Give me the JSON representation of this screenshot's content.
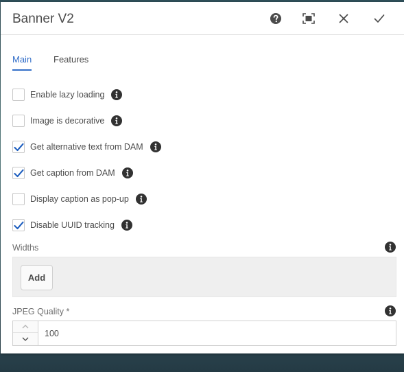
{
  "dialog": {
    "title": "Banner V2"
  },
  "tabs": [
    {
      "label": "Main",
      "active": true
    },
    {
      "label": "Features",
      "active": false
    }
  ],
  "checkboxes": [
    {
      "label": "Enable lazy loading",
      "checked": false
    },
    {
      "label": "Image is decorative",
      "checked": false
    },
    {
      "label": "Get alternative text from DAM",
      "checked": true
    },
    {
      "label": "Get caption from DAM",
      "checked": true
    },
    {
      "label": "Display caption as pop-up",
      "checked": false
    },
    {
      "label": "Disable UUID tracking",
      "checked": true
    }
  ],
  "widths": {
    "label": "Widths",
    "add_label": "Add"
  },
  "jpeg_quality": {
    "label": "JPEG Quality *",
    "value": "100"
  },
  "colors": {
    "accent": "#326ec8",
    "check": "#1f5fbf",
    "text": "#4b4b4b"
  },
  "icons": {
    "help": "help-icon",
    "fullscreen": "fullscreen-icon",
    "close": "close-icon",
    "done": "checkmark-icon",
    "info": "info-icon"
  }
}
